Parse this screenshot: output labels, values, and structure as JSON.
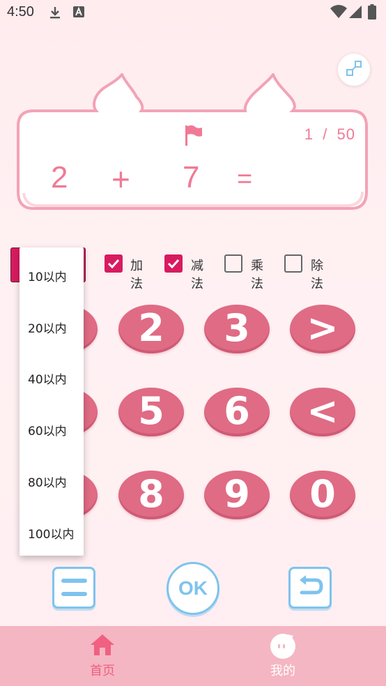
{
  "status_bar": {
    "time": "4:50",
    "icons": [
      "download-icon",
      "font-a-icon",
      "wifi-icon",
      "signal-icon",
      "battery-icon"
    ]
  },
  "toolbar": {
    "expand_icon": "expand-icon"
  },
  "question": {
    "flag_icon": "flag-icon",
    "progress_current": "1",
    "progress_separator": "/",
    "progress_total": "50",
    "operand_a": "2",
    "operator": "+",
    "operand_b": "7",
    "equals": "="
  },
  "operations": [
    {
      "label": "加法",
      "checked": true
    },
    {
      "label": "减法",
      "checked": true
    },
    {
      "label": "乘法",
      "checked": false
    },
    {
      "label": "除法",
      "checked": false
    }
  ],
  "range_dropdown": {
    "options": [
      "10以内",
      "20以内",
      "40以内",
      "60以内",
      "80以内",
      "100以内"
    ]
  },
  "keypad": {
    "rows": [
      [
        "2",
        "3",
        ">"
      ],
      [
        "5",
        "6",
        "<"
      ],
      [
        "8",
        "9",
        "0"
      ]
    ]
  },
  "actions": {
    "menu_icon": "menu-icon",
    "ok_label": "OK",
    "back_icon": "undo-icon"
  },
  "bottom_nav": {
    "items": [
      {
        "label": "首页",
        "icon": "home-icon",
        "active": true
      },
      {
        "label": "我的",
        "icon": "profile-icon",
        "active": false
      }
    ]
  },
  "colors": {
    "accent": "#d81b60",
    "key": "#e06b84",
    "text_pink": "#f07a95",
    "button_blue": "#7ec3ee",
    "nav_bg": "#f4b6c2",
    "nav_active": "#f06080",
    "nav_inactive": "#ffffff"
  }
}
